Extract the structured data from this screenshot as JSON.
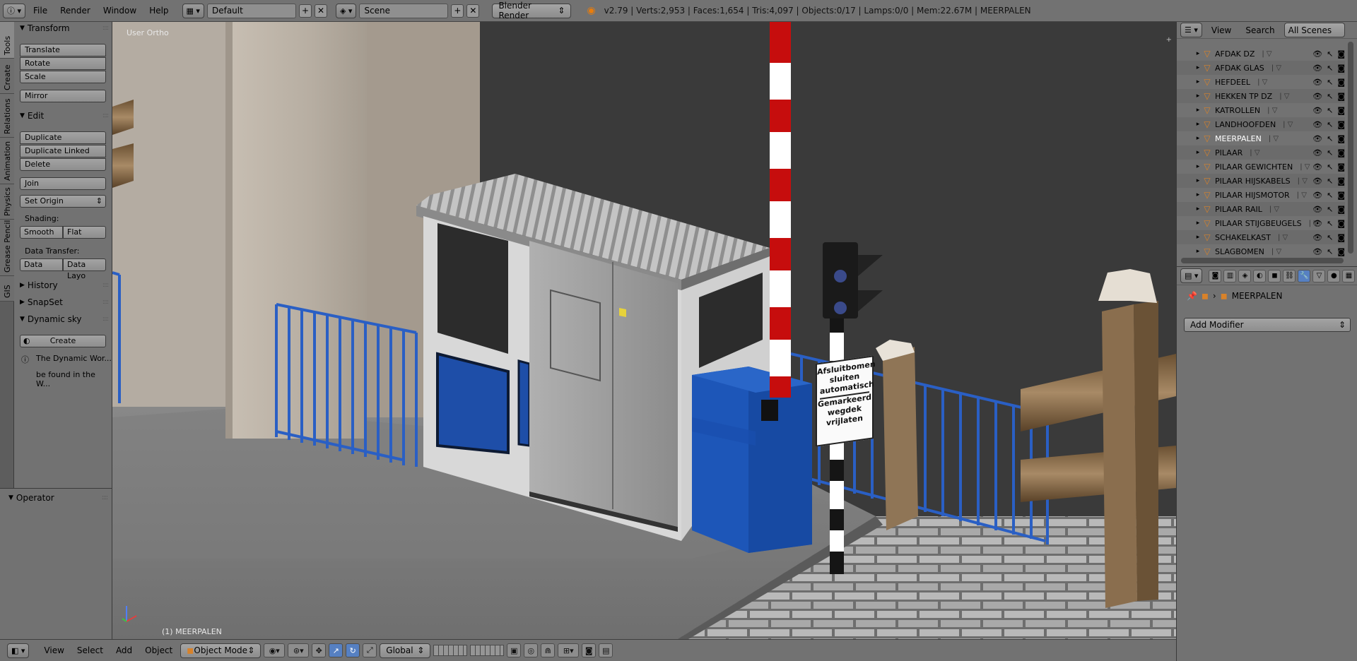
{
  "header": {
    "menus": [
      "File",
      "Render",
      "Window",
      "Help"
    ],
    "layout": "Default",
    "scene": "Scene",
    "engine": "Blender Render",
    "stats": "v2.79 | Verts:2,953 | Faces:1,654 | Tris:4,097 | Objects:0/17 | Lamps:0/0 | Mem:22.67M | MEERPALEN"
  },
  "vtabs": [
    "Tools",
    "Create",
    "Relations",
    "Animation",
    "Physics",
    "Grease Pencil",
    "GIS"
  ],
  "toolshelf": {
    "transform_title": "Transform",
    "translate": "Translate",
    "rotate": "Rotate",
    "scale": "Scale",
    "mirror": "Mirror",
    "edit_title": "Edit",
    "duplicate": "Duplicate",
    "duplicate_linked": "Duplicate Linked",
    "delete": "Delete",
    "join": "Join",
    "set_origin": "Set Origin",
    "shading_label": "Shading:",
    "smooth": "Smooth",
    "flat": "Flat",
    "data_transfer_label": "Data Transfer:",
    "data": "Data",
    "data_layo": "Data Layo",
    "history": "History",
    "snapset": "SnapSet",
    "dynamic_sky": "Dynamic sky",
    "create": "Create",
    "info_line1": "The Dynamic Wor...",
    "info_line2": "be found in the W..."
  },
  "operator": {
    "title": "Operator"
  },
  "viewport": {
    "view_label": "User Ortho",
    "object_label": "(1) MEERPALEN",
    "sign_lines": [
      "Afsluitbomen",
      "sluiten",
      "automatisch",
      "Gemarkeerd",
      "wegdek",
      "vrijlaten"
    ]
  },
  "bottombar": {
    "menus": [
      "View",
      "Select",
      "Add",
      "Object"
    ],
    "mode": "Object Mode",
    "orientation": "Global"
  },
  "outliner": {
    "view": "View",
    "search": "Search",
    "scenes": "All Scenes",
    "rows": [
      "AFDAK DZ",
      "AFDAK GLAS",
      "HEFDEEL",
      "HEKKEN TP DZ",
      "KATROLLEN",
      "LANDHOOFDEN",
      "MEERPALEN",
      "PILAAR",
      "PILAAR GEWICHTEN",
      "PILAAR HIJSKABELS",
      "PILAAR HIJSMOTOR",
      "PILAAR RAIL",
      "PILAAR STIJGBEUGELS",
      "SCHAKELKAST",
      "SLAGBOMEN"
    ],
    "selected": "MEERPALEN"
  },
  "properties": {
    "object_name": "MEERPALEN",
    "add_modifier": "Add Modifier"
  }
}
